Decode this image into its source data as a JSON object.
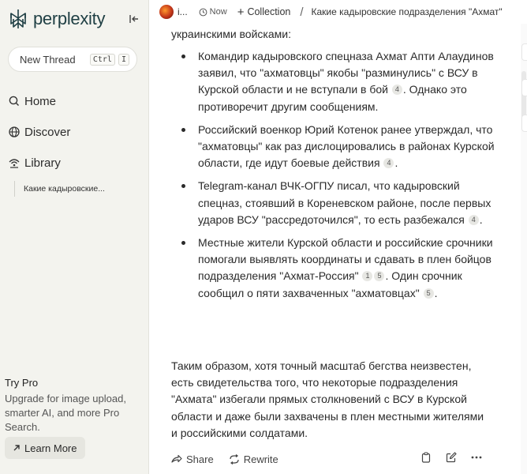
{
  "sidebar": {
    "logo_text": "perplexity",
    "new_thread": {
      "label": "New Thread",
      "shortcut_keys": [
        "Ctrl",
        "I"
      ]
    },
    "nav": [
      {
        "label": "Home",
        "icon": "search-icon"
      },
      {
        "label": "Discover",
        "icon": "globe-icon"
      },
      {
        "label": "Library",
        "icon": "library-icon"
      }
    ],
    "history": [
      "Какие кадыровские..."
    ],
    "try_pro": {
      "title": "Try Pro",
      "description": "Upgrade for image upload, smarter AI, and more Pro Search.",
      "button": "Learn More"
    }
  },
  "topbar": {
    "user": "i...",
    "time": "Now",
    "collection": "Collection",
    "separator": "/",
    "thread_title": "Какие кадыровские подразделения \"Ахмат\""
  },
  "answer": {
    "intro_fragment": "украинскими войсками:",
    "bullets": [
      {
        "text": "Командир кадыровского спецназа Ахмат Апти Алаудинов заявил, что \"ахматовцы\" якобы \"разминулись\" с ВСУ в Курской области и не вступали в бой",
        "cites": [
          "4"
        ],
        "tail": ". Однако это противоречит другим сообщениям."
      },
      {
        "text": "Российский военкор Юрий Котенок ранее утверждал, что \"ахматовцы\" как раз дислоцировались в районах Курской области, где идут боевые действия",
        "cites": [
          "4"
        ],
        "tail": "."
      },
      {
        "text": "Telegram-канал ВЧК-ОГПУ писал, что кадыровский спецназ, стоявший в Кореневском районе, после первых ударов ВСУ \"рассредоточился\", то есть разбежался",
        "cites": [
          "4"
        ],
        "tail": "."
      },
      {
        "text": "Местные жители Курской области и российские срочники помогали выявлять координаты и сдавать в плен бойцов подразделения \"Ахмат-Россия\"",
        "cites": [
          "1",
          "5"
        ],
        "tail": ". Один срочник сообщил о пяти захваченных \"ахматовцах\"",
        "cites2": [
          "5"
        ],
        "tail2": "."
      }
    ],
    "summary": "Таким образом, хотя точный масштаб бегства неизвестен, есть свидетельства того, что некоторые подразделения \"Ахмата\" избегали прямых столкновений с ВСУ в Курской области и даже были захвачены в плен местными жителями и российскими солдатами."
  },
  "actions": {
    "share": "Share",
    "rewrite": "Rewrite"
  },
  "colors": {
    "sidebar_bg": "#f3f3ee",
    "brand": "#1f3f44",
    "text": "#2a2a2a"
  }
}
